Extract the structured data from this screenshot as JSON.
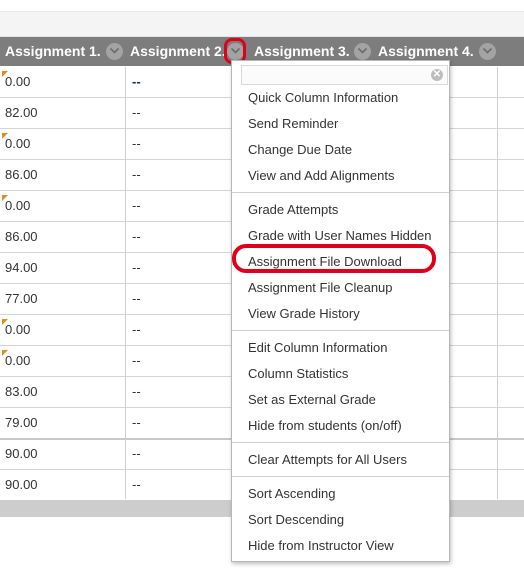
{
  "columns": [
    {
      "label": "Assignment 1."
    },
    {
      "label": "Assignment 2."
    },
    {
      "label": "Assignment 3."
    },
    {
      "label": "Assignment 4."
    }
  ],
  "rows": [
    {
      "a1": "0.00",
      "a2": "--",
      "flag": true
    },
    {
      "a1": "82.00",
      "a2": "--",
      "flag": false
    },
    {
      "a1": "0.00",
      "a2": "--",
      "flag": true
    },
    {
      "a1": "86.00",
      "a2": "--",
      "flag": false
    },
    {
      "a1": "0.00",
      "a2": "--",
      "flag": true
    },
    {
      "a1": "86.00",
      "a2": "--",
      "flag": false
    },
    {
      "a1": "94.00",
      "a2": "--",
      "flag": false
    },
    {
      "a1": "77.00",
      "a2": "--",
      "flag": false
    },
    {
      "a1": "0.00",
      "a2": "--",
      "flag": true
    },
    {
      "a1": "0.00",
      "a2": "--",
      "flag": true
    },
    {
      "a1": "83.00",
      "a2": "--",
      "flag": false
    },
    {
      "a1": "79.00",
      "a2": "--",
      "flag": false
    },
    {
      "a1": "90.00",
      "a2": "--",
      "flag": false
    },
    {
      "a1": "90.00",
      "a2": "--",
      "flag": false
    }
  ],
  "menu": {
    "close_icon": "close-icon",
    "groups": [
      [
        "Quick Column Information",
        "Send Reminder",
        "Change Due Date",
        "View and Add Alignments"
      ],
      [
        "Grade Attempts",
        "Grade with User Names Hidden",
        "Assignment File Download",
        "Assignment File Cleanup",
        "View Grade History"
      ],
      [
        "Edit Column Information",
        "Column Statistics",
        "Set as External Grade",
        "Hide from students (on/off)"
      ],
      [
        "Clear Attempts for All Users"
      ],
      [
        "Sort Ascending",
        "Sort Descending",
        "Hide from Instructor View"
      ]
    ],
    "highlighted_item": "Assignment File Download"
  },
  "colors": {
    "header_bg": "#7d7d7d",
    "flag": "#e38b1c",
    "annotation_red": "#e0001a"
  }
}
